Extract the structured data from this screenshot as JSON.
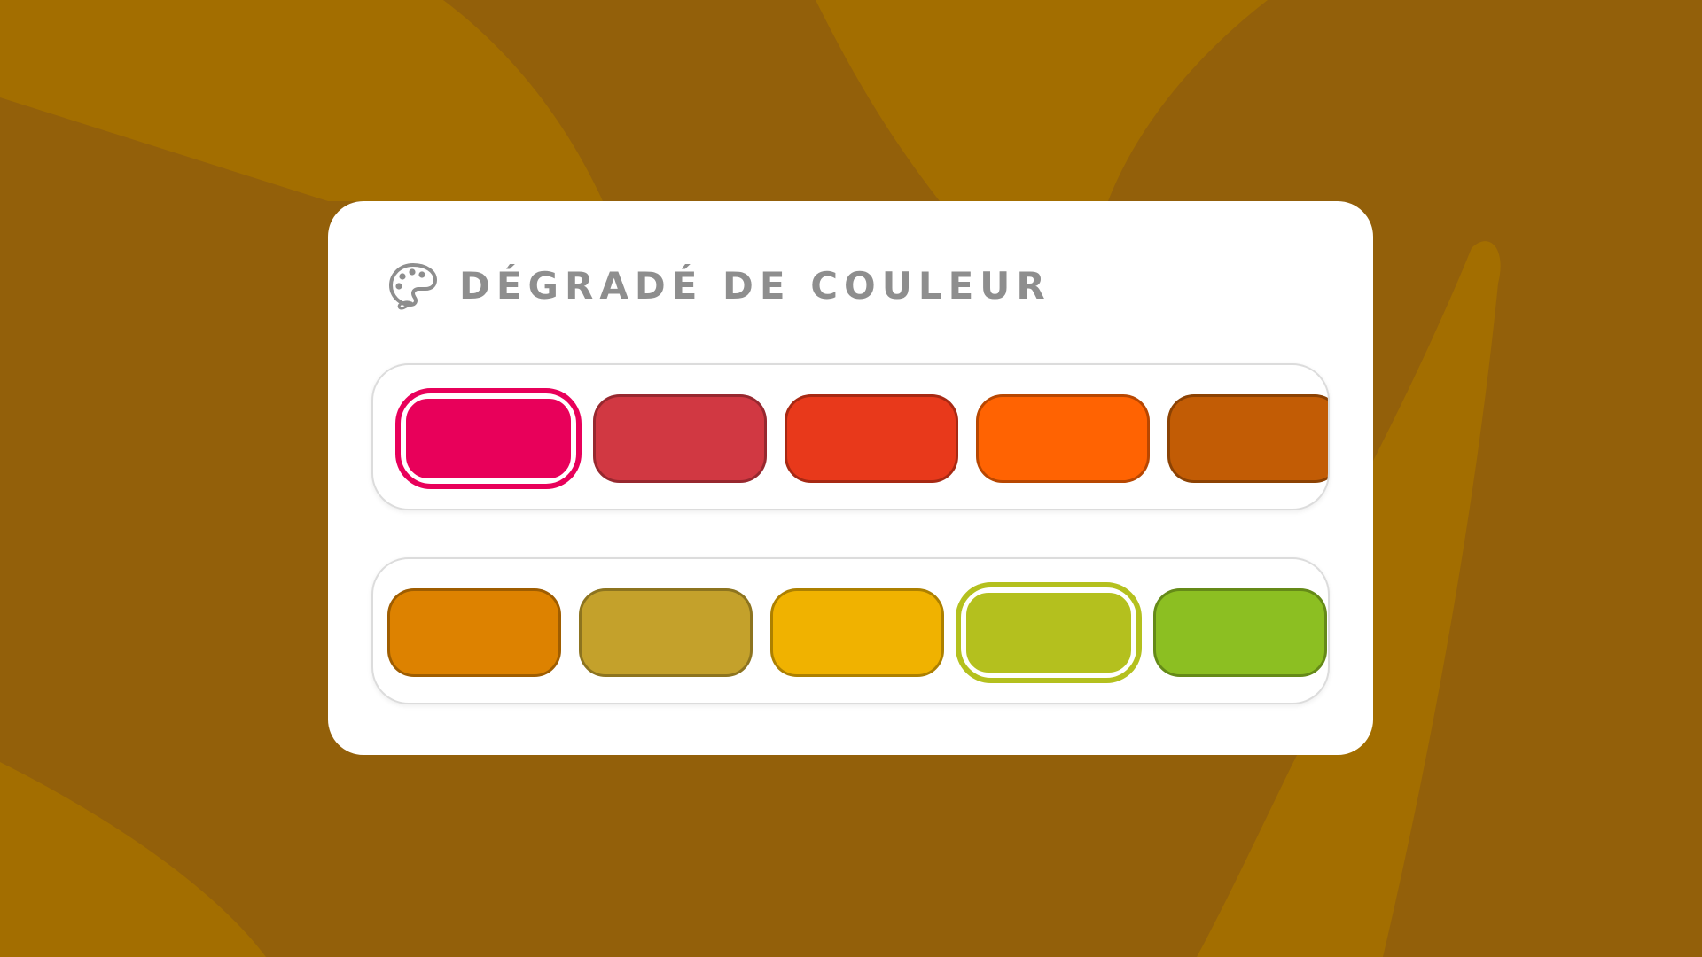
{
  "panel": {
    "title": "DÉGRADÉ DE COULEUR",
    "icon": "palette-icon",
    "title_color": "#8e8e8e"
  },
  "rows": [
    {
      "swatches": [
        {
          "color": "#e8005a",
          "selected": true
        },
        {
          "color": "#d13842",
          "selected": false
        },
        {
          "color": "#e8391b",
          "selected": false
        },
        {
          "color": "#ff6302",
          "selected": false
        },
        {
          "color": "#c25c05",
          "selected": false
        }
      ]
    },
    {
      "swatches": [
        {
          "color": "#dd8200",
          "selected": false
        },
        {
          "color": "#c4a12b",
          "selected": false
        },
        {
          "color": "#f0b200",
          "selected": false
        },
        {
          "color": "#b4c01e",
          "selected": true
        },
        {
          "color": "#8cbf22",
          "selected": false
        }
      ]
    }
  ],
  "background": {
    "base_color": "#93600a",
    "band_color": "#a36e00"
  }
}
